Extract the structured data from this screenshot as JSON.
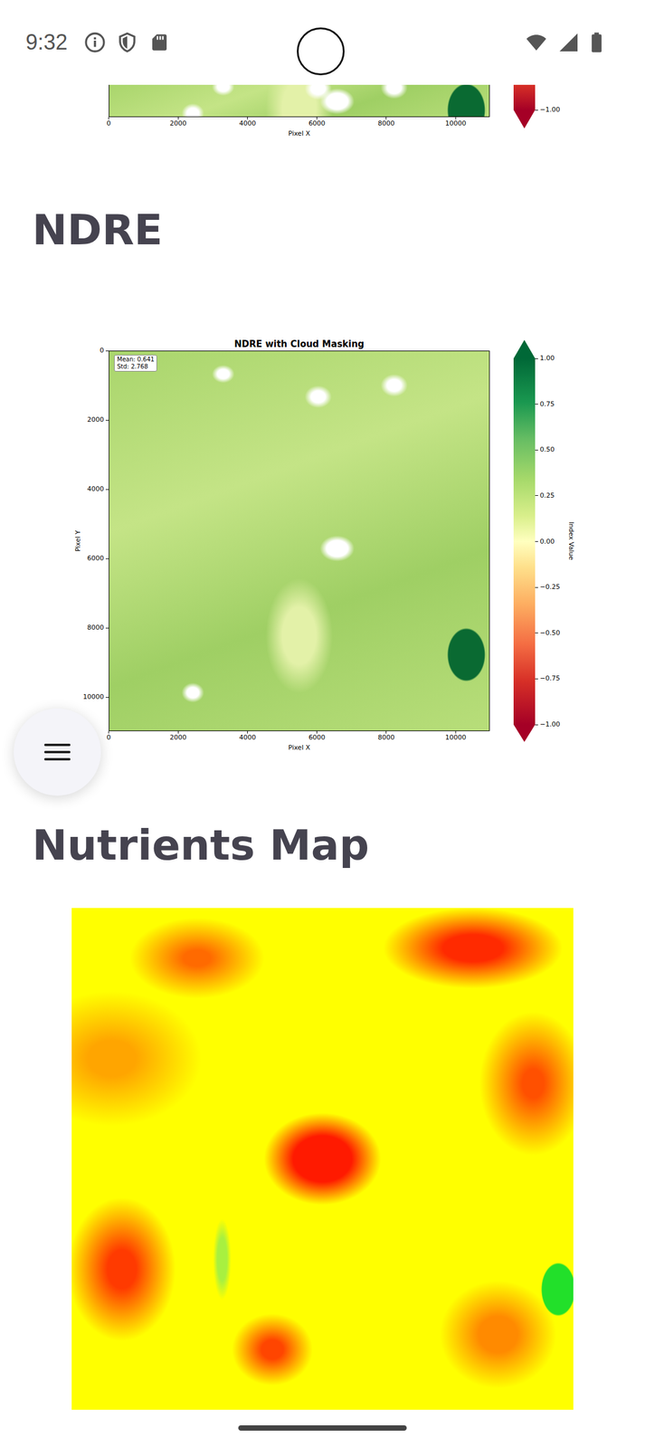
{
  "status_bar": {
    "time": "9:32"
  },
  "previous_chart": {
    "x_ticks": [
      "0",
      "2000",
      "4000",
      "6000",
      "8000",
      "10000"
    ],
    "x_label": "Pixel X",
    "colorbar_ticks": [
      "−1.00"
    ]
  },
  "ndre": {
    "heading": "NDRE",
    "chart": {
      "title": "NDRE with Cloud Masking",
      "stats": [
        "Mean: 0.641",
        "Std: 2.768"
      ],
      "y_label": "Pixel Y",
      "y_ticks": [
        "0",
        "2000",
        "4000",
        "6000",
        "8000",
        "10000"
      ],
      "x_label": "Pixel X",
      "x_ticks": [
        "0",
        "2000",
        "4000",
        "6000",
        "8000",
        "10000"
      ],
      "colorbar_label": "Index Value",
      "colorbar_ticks": [
        "1.00",
        "0.75",
        "0.50",
        "0.25",
        "0.00",
        "−0.25",
        "−0.50",
        "−0.75",
        "−1.00"
      ]
    }
  },
  "nutrients": {
    "heading": "Nutrients Map"
  }
}
